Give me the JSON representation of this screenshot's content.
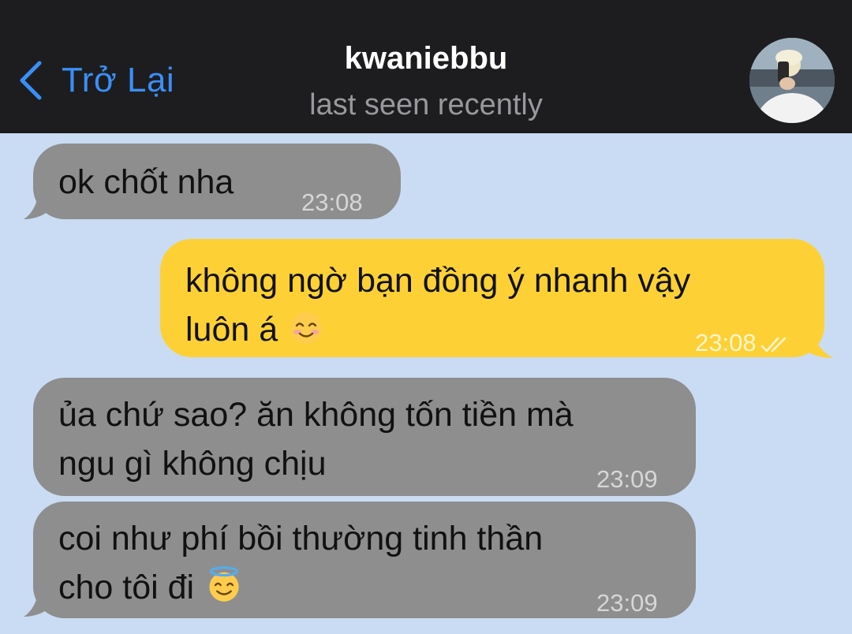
{
  "header": {
    "back_label": "Trở Lại",
    "contact_name": "kwaniebbu",
    "status": "last seen recently"
  },
  "messages": [
    {
      "direction": "incoming",
      "lines": [
        "ok chốt nha"
      ],
      "time": "23:08"
    },
    {
      "direction": "outgoing",
      "lines": [
        "không ngờ bạn đồng ý nhanh vậy",
        "luôn á"
      ],
      "emoji": "smiling-blush-emoji",
      "time": "23:08",
      "status": "read"
    },
    {
      "direction": "incoming",
      "lines": [
        "ủa chứ sao? ăn không tốn tiền mà",
        "ngu gì không chịu"
      ],
      "time": "23:09"
    },
    {
      "direction": "incoming",
      "lines": [
        "coi như phí bồi thường tinh thần",
        "cho tôi đi"
      ],
      "emoji": "halo-smile-emoji",
      "time": "23:09"
    }
  ],
  "colors": {
    "background": "#c9dcf3",
    "header": "#1d1d1f",
    "accent": "#3a8ff7",
    "incoming_bubble": "#8e8e8e",
    "outgoing_bubble": "#fdd135"
  }
}
